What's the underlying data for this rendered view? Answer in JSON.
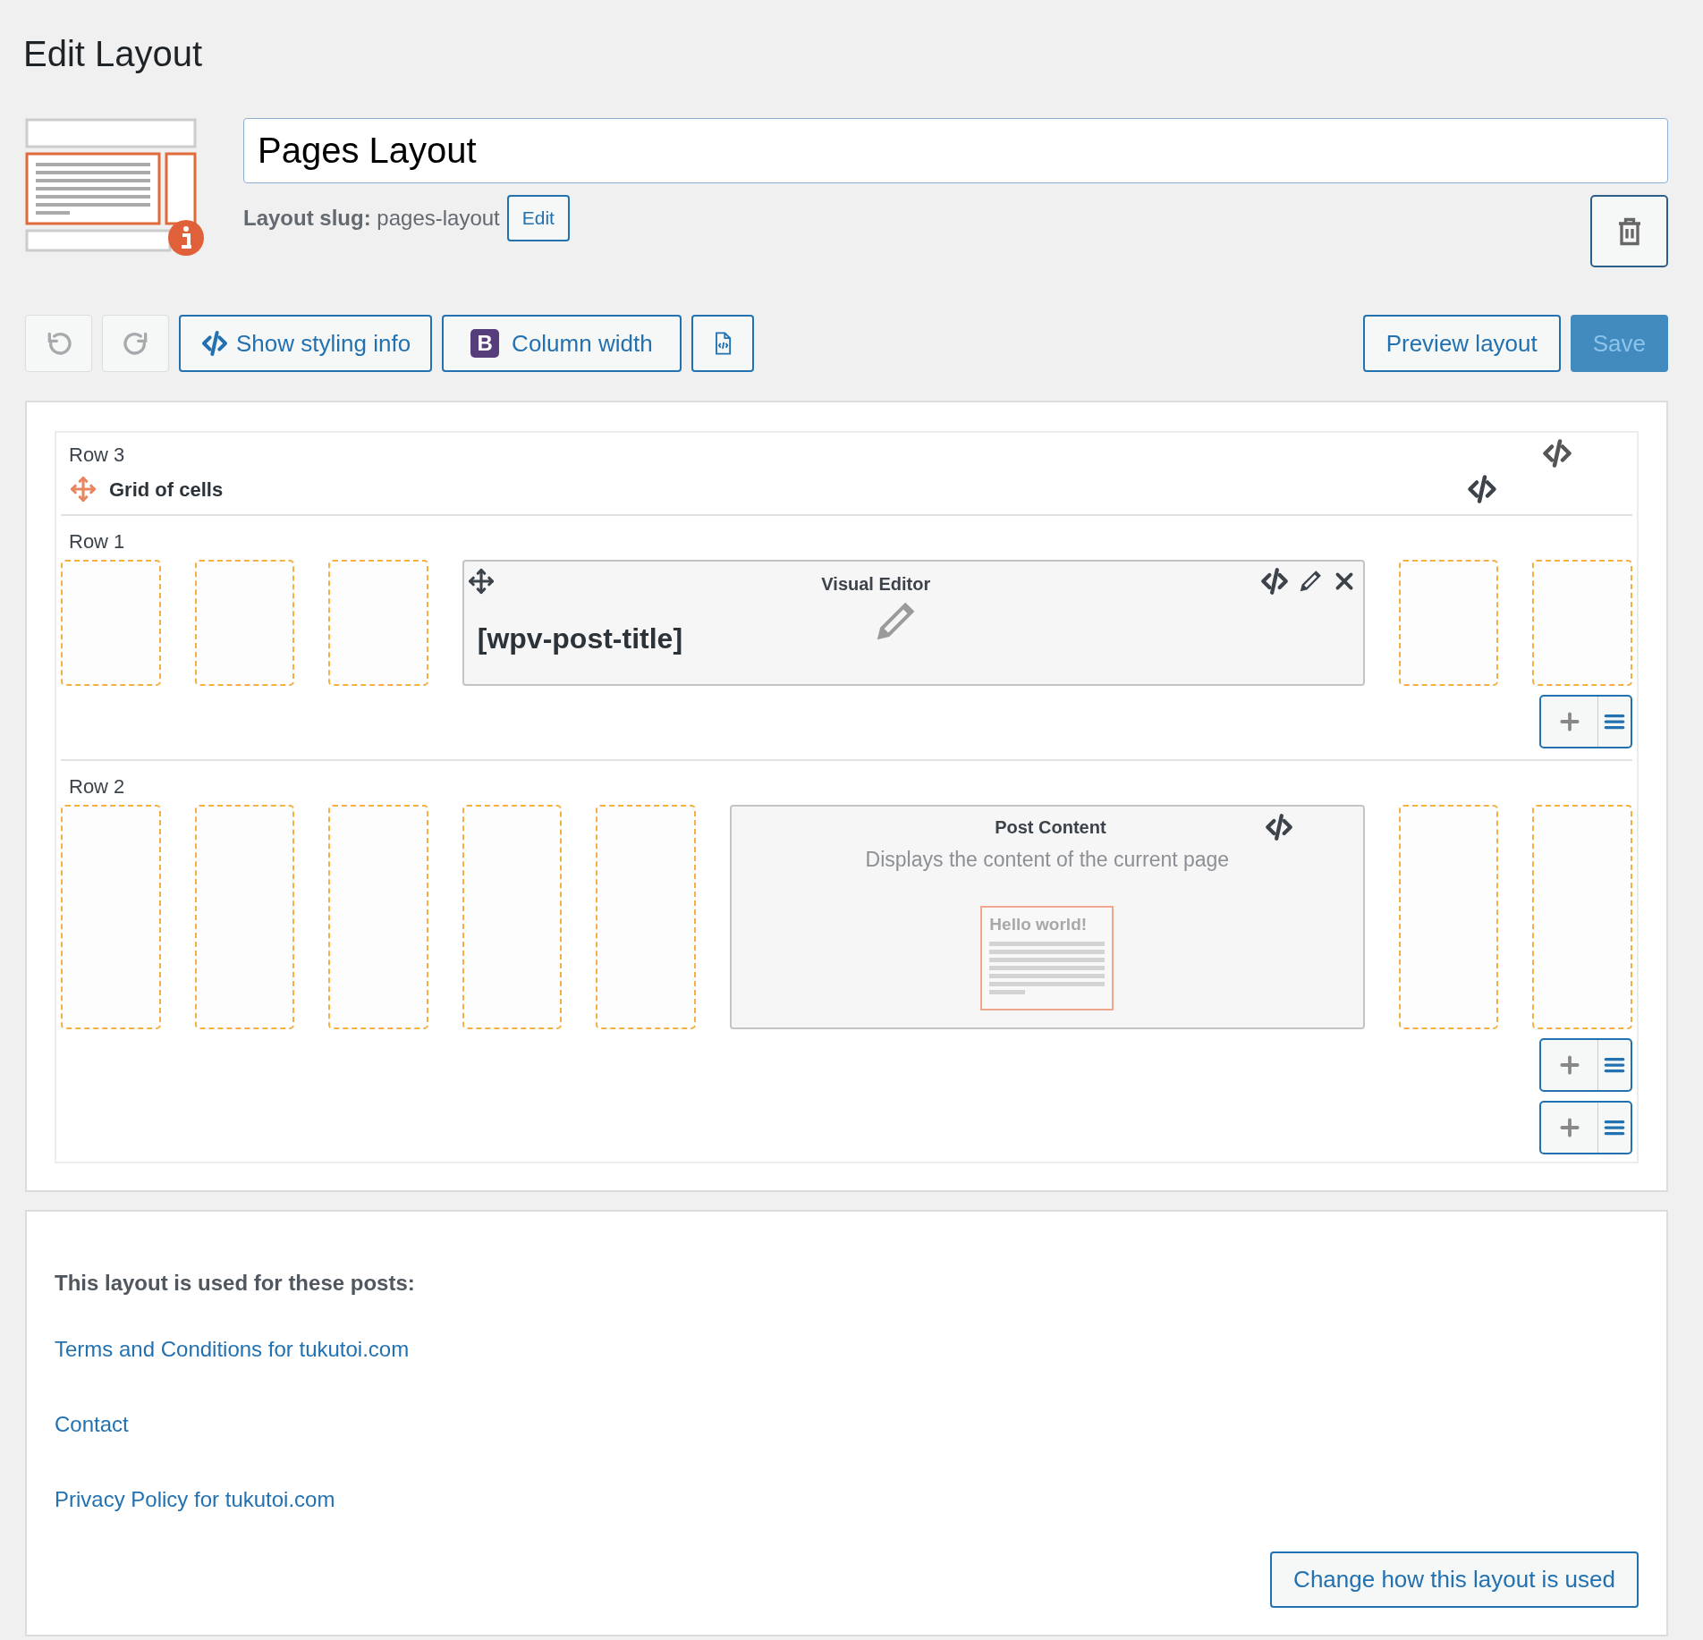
{
  "page_title": "Edit Layout",
  "layout": {
    "name": "Pages Layout",
    "slug_label": "Layout slug:",
    "slug": "pages-layout",
    "edit_button": "Edit"
  },
  "toolbar": {
    "styling_button": "Show styling info",
    "column_width": {
      "badge": "B",
      "label": "Column width"
    },
    "preview_button": "Preview layout",
    "save_button": {
      "label": "Save",
      "disabled": true
    }
  },
  "rows": [
    {
      "label": "Row 3",
      "cells": [
        {
          "kind": "grid",
          "title": "Grid of cells",
          "rows": [
            {
              "label": "Row 1",
              "cells": [
                {
                  "kind": "empty"
                },
                {
                  "kind": "empty"
                },
                {
                  "kind": "empty"
                },
                {
                  "kind": "visual_editor",
                  "title": "Visual Editor",
                  "content": "[wpv-post-title]"
                },
                {
                  "kind": "empty"
                },
                {
                  "kind": "empty"
                }
              ]
            },
            {
              "label": "Row 2",
              "cells": [
                {
                  "kind": "empty"
                },
                {
                  "kind": "empty"
                },
                {
                  "kind": "empty"
                },
                {
                  "kind": "empty"
                },
                {
                  "kind": "empty"
                },
                {
                  "kind": "post_content",
                  "title": "Post Content",
                  "description": "Displays the content of the current page",
                  "preview_heading": "Hello world!"
                },
                {
                  "kind": "empty"
                },
                {
                  "kind": "empty"
                }
              ]
            }
          ]
        }
      ]
    }
  ],
  "usage": {
    "heading": "This layout is used for these posts:",
    "posts": [
      "Terms and Conditions for tukutoi.com",
      "Contact",
      "Privacy Policy for tukutoi.com"
    ],
    "button": "Change how this layout is used"
  }
}
